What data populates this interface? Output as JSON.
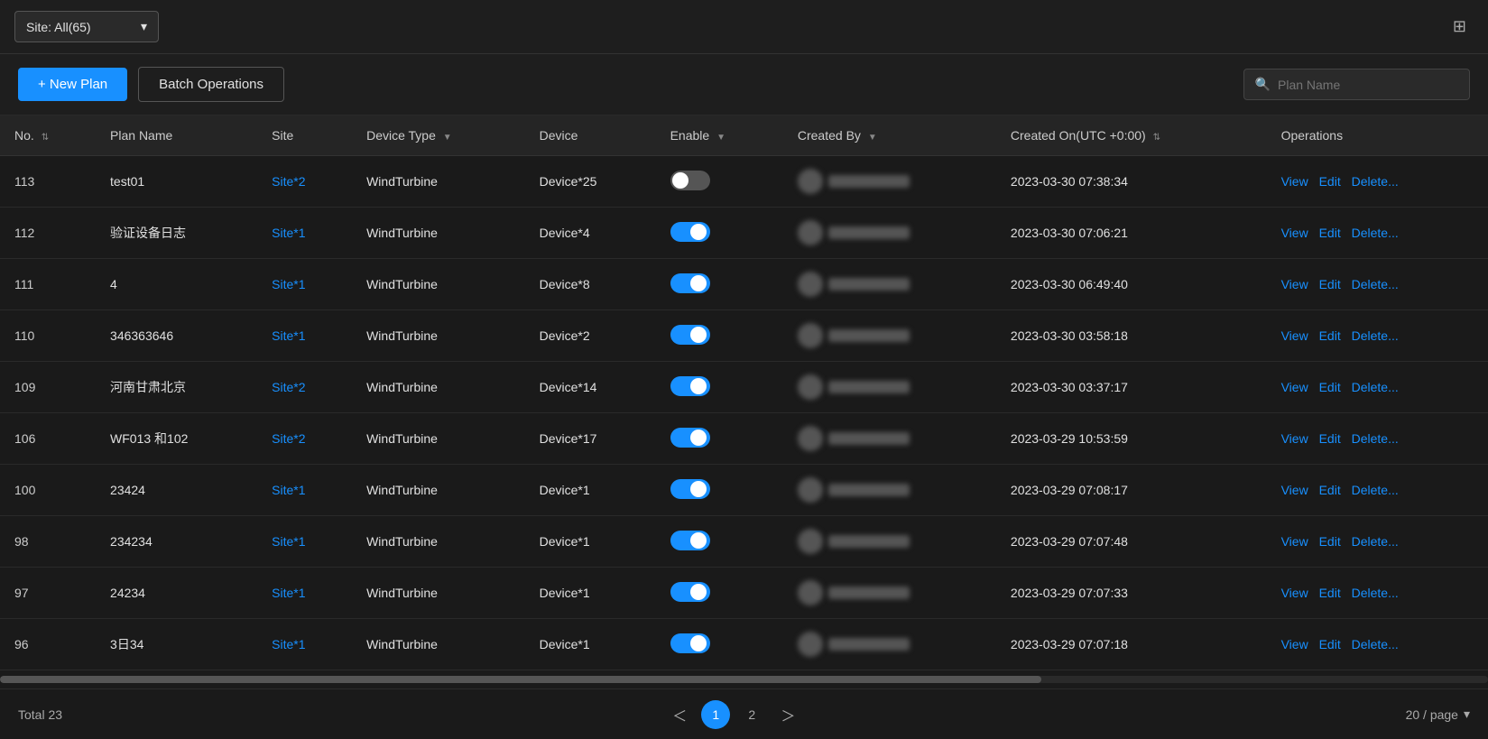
{
  "topbar": {
    "site_selector_label": "Site: All(65)",
    "icon_label": "📋"
  },
  "toolbar": {
    "new_plan_label": "+ New Plan",
    "batch_operations_label": "Batch Operations",
    "search_placeholder": "Plan Name"
  },
  "table": {
    "columns": [
      {
        "key": "no",
        "label": "No.",
        "sortable": true
      },
      {
        "key": "plan_name",
        "label": "Plan Name",
        "sortable": false
      },
      {
        "key": "site",
        "label": "Site",
        "sortable": false
      },
      {
        "key": "device_type",
        "label": "Device Type",
        "filterable": true
      },
      {
        "key": "device",
        "label": "Device",
        "sortable": false
      },
      {
        "key": "enable",
        "label": "Enable",
        "filterable": true
      },
      {
        "key": "created_by",
        "label": "Created By",
        "filterable": true
      },
      {
        "key": "created_on",
        "label": "Created On(UTC +0:00)",
        "sortable": true
      },
      {
        "key": "operations",
        "label": "Operations",
        "sortable": false
      }
    ],
    "rows": [
      {
        "no": "113",
        "plan_name": "test01",
        "site": "Site*2",
        "device_type": "WindTurbine",
        "device": "Device*25",
        "enable": false,
        "created_on": "2023-03-30 07:38:34"
      },
      {
        "no": "112",
        "plan_name": "验证设备日志",
        "site": "Site*1",
        "device_type": "WindTurbine",
        "device": "Device*4",
        "enable": true,
        "created_on": "2023-03-30 07:06:21"
      },
      {
        "no": "111",
        "plan_name": "4",
        "site": "Site*1",
        "device_type": "WindTurbine",
        "device": "Device*8",
        "enable": true,
        "created_on": "2023-03-30 06:49:40"
      },
      {
        "no": "110",
        "plan_name": "346363646",
        "site": "Site*1",
        "device_type": "WindTurbine",
        "device": "Device*2",
        "enable": true,
        "created_on": "2023-03-30 03:58:18"
      },
      {
        "no": "109",
        "plan_name": "河南甘肃北京",
        "site": "Site*2",
        "device_type": "WindTurbine",
        "device": "Device*14",
        "enable": true,
        "created_on": "2023-03-30 03:37:17"
      },
      {
        "no": "106",
        "plan_name": "WF013 和102",
        "site": "Site*2",
        "device_type": "WindTurbine",
        "device": "Device*17",
        "enable": true,
        "created_on": "2023-03-29 10:53:59"
      },
      {
        "no": "100",
        "plan_name": "23424",
        "site": "Site*1",
        "device_type": "WindTurbine",
        "device": "Device*1",
        "enable": true,
        "created_on": "2023-03-29 07:08:17"
      },
      {
        "no": "98",
        "plan_name": "234234",
        "site": "Site*1",
        "device_type": "WindTurbine",
        "device": "Device*1",
        "enable": true,
        "created_on": "2023-03-29 07:07:48"
      },
      {
        "no": "97",
        "plan_name": "24234",
        "site": "Site*1",
        "device_type": "WindTurbine",
        "device": "Device*1",
        "enable": true,
        "created_on": "2023-03-29 07:07:33"
      },
      {
        "no": "96",
        "plan_name": "3日34",
        "site": "Site*1",
        "device_type": "WindTurbine",
        "device": "Device*1",
        "enable": true,
        "created_on": "2023-03-29 07:07:18"
      }
    ],
    "op_view": "View",
    "op_edit": "Edit",
    "op_delete": "Delete..."
  },
  "footer": {
    "total_label": "Total 23",
    "page_current": "1",
    "page_next": "2",
    "page_size_label": "20 / page"
  }
}
